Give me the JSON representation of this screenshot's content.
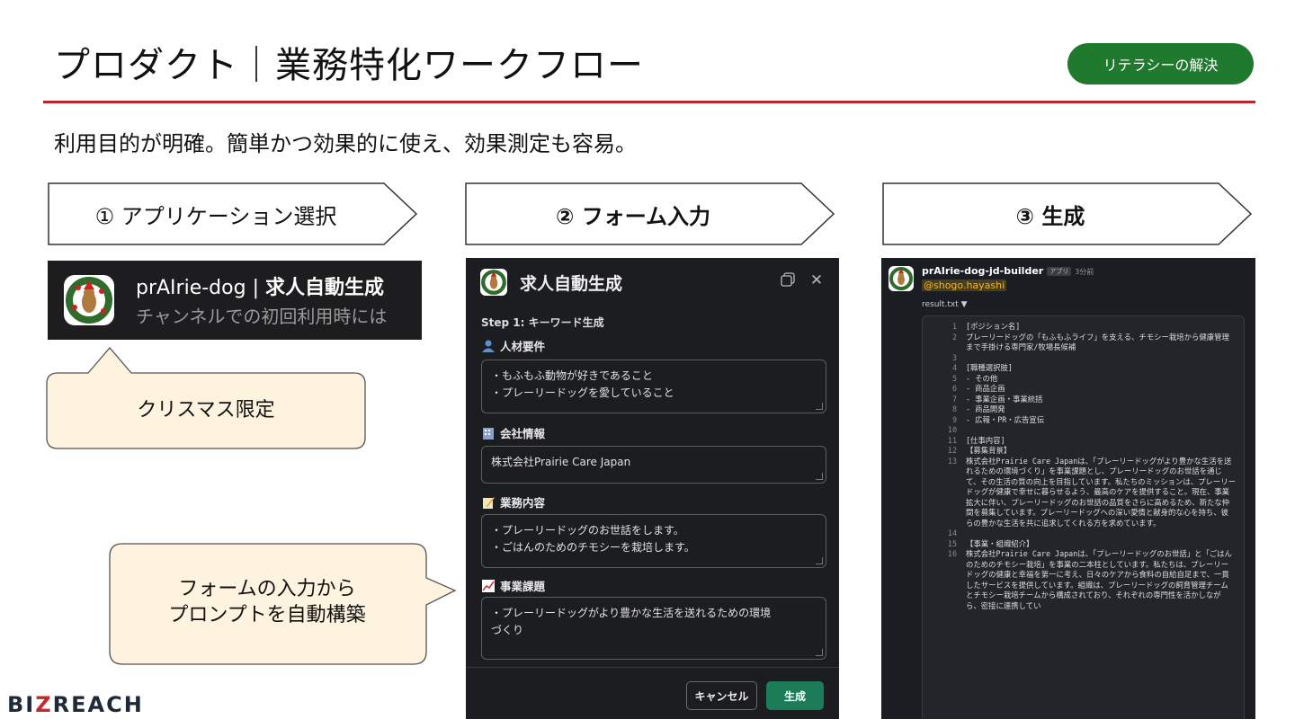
{
  "header": {
    "title": "プロダクト｜業務特化ワークフロー",
    "badge": "リテラシーの解決",
    "subtitle": "利用目的が明確。簡単かつ効果的に使え、効果測定も容易。"
  },
  "steps": [
    {
      "label": "① アプリケーション選択"
    },
    {
      "label": "② フォーム入力"
    },
    {
      "label": "③ 生成"
    }
  ],
  "app_card": {
    "name": "prAIrie-dog",
    "sep": " | ",
    "title": "求人自動生成",
    "subtitle": "チャンネルでの初回利用時には"
  },
  "callouts": {
    "christmas": "クリスマス限定",
    "prompt": "フォームの入力から\nプロンプトを自動構築"
  },
  "form": {
    "title": "求人自動生成",
    "step": "Step 1: キーワード生成",
    "fields": [
      {
        "label": "人材要件",
        "icon": "person-icon",
        "value": "・もふもふ動物が好きであること\n・プレーリードッグを愛していること"
      },
      {
        "label": "会社情報",
        "icon": "building-icon",
        "value": "株式会社Prairie Care Japan"
      },
      {
        "label": "業務内容",
        "icon": "memo-icon",
        "value": "・プレーリードッグのお世話をします。\n・ごはんのためのチモシーを栽培します。"
      },
      {
        "label": "事業課題",
        "icon": "chart-up-icon",
        "value": "・プレーリードッグがより豊かな生活を送れるための環境\nづくり"
      }
    ],
    "cancel": "キャンセル",
    "submit": "生成"
  },
  "result": {
    "bot_name": "prAIrie-dog-jd-builder",
    "app_tag": "アプリ",
    "time": "3分前",
    "mention": "@shogo.hayashi",
    "file": "result.txt ▼",
    "lines": [
      {
        "n": "1",
        "t": "[ポジション名]"
      },
      {
        "n": "2",
        "t": "プレーリードッグの「もふもふライフ」を支える、チモシー栽培から健康管理まで手掛ける専門家/牧場長候補"
      },
      {
        "n": "3",
        "t": ""
      },
      {
        "n": "4",
        "t": "[職種選択肢]"
      },
      {
        "n": "5",
        "t": "- その他"
      },
      {
        "n": "6",
        "t": "- 商品企画"
      },
      {
        "n": "7",
        "t": "- 事業企画・事業統括"
      },
      {
        "n": "8",
        "t": "- 商品開発"
      },
      {
        "n": "9",
        "t": "- 広報・PR・広告宣伝"
      },
      {
        "n": "10",
        "t": ""
      },
      {
        "n": "11",
        "t": "[仕事内容]"
      },
      {
        "n": "12",
        "t": "【募集背景】"
      },
      {
        "n": "13",
        "t": "株式会社Prairie Care Japanは、「プレーリードッグがより豊かな生活を送れるための環境づくり」を事業課題とし、プレーリードッグのお世話を通じて、その生活の質の向上を目指しています。私たちのミッションは、プレーリードッグが健康で幸せに暮らせるよう、最高のケアを提供すること。現在、事業拡大に伴い、プレーリードッグのお世話の品質をさらに高めるため、新たな仲間を募集しています。プレーリードッグへの深い愛情と献身的な心を持ち、彼らの豊かな生活を共に追求してくれる方を求めています。"
      },
      {
        "n": "14",
        "t": ""
      },
      {
        "n": "15",
        "t": "【事業・組織紹介】"
      },
      {
        "n": "16",
        "t": "株式会社Prairie Care Japanは、「プレーリードッグのお世話」と「ごはんのためのチモシー栽培」を事業の二本柱としています。私たちは、プレーリードッグの健康と幸福を第一に考え、日々のケアから食料の自給自足まで、一貫したサービスを提供しています。組織は、プレーリードッグの飼育管理チームとチモシー栽培チームから構成されており、それぞれの専門性を活かしながら、密接に連携してい"
      }
    ]
  },
  "footer": {
    "logo_a": "BI",
    "logo_z": "Z",
    "logo_b": "REACH"
  },
  "colors": {
    "accent": "#b3262b",
    "badge": "#1f7a2e",
    "submit": "#1d7c58",
    "callout": "#fdf3df"
  }
}
